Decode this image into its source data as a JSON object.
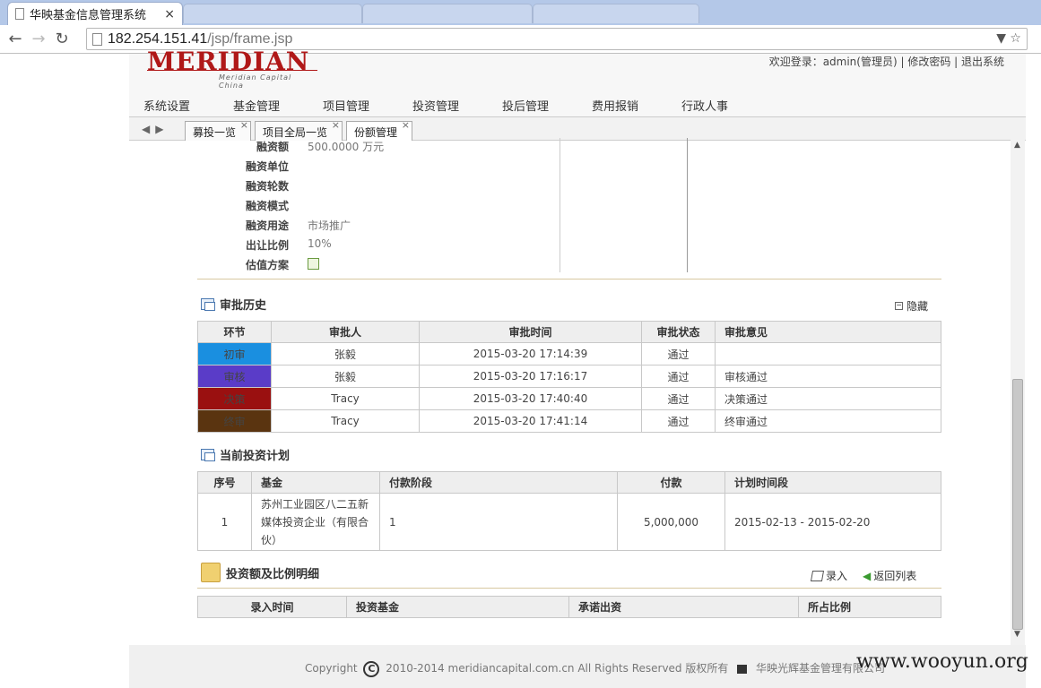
{
  "browser": {
    "tab_title": "华映基金信息管理系统",
    "tab_close": "×",
    "url_host": "182.254.151.41",
    "url_path": "/jsp/frame.jsp"
  },
  "header": {
    "logo_text": "MERIDIAN",
    "logo_sub": "Meridian Capital China",
    "userbar": "欢迎登录：admin(管理员) | 修改密码 | 退出系统",
    "nav": [
      "系统设置",
      "基金管理",
      "项目管理",
      "投资管理",
      "投后管理",
      "费用报销",
      "行政人事"
    ]
  },
  "tabs": [
    {
      "label": "募投一览",
      "close": "×"
    },
    {
      "label": "项目全局一览",
      "close": "×"
    },
    {
      "label": "份额管理",
      "close": "×"
    }
  ],
  "fields": [
    {
      "label": "融资额",
      "value": "500.0000 万元"
    },
    {
      "label": "融资单位",
      "value": ""
    },
    {
      "label": "融资轮数",
      "value": ""
    },
    {
      "label": "融资模式",
      "value": ""
    },
    {
      "label": "融资用途",
      "value": "市场推广"
    },
    {
      "label": "出让比例",
      "value": "10%"
    },
    {
      "label": "估值方案",
      "value": ""
    }
  ],
  "approval": {
    "title": "审批历史",
    "hide_label": "隐藏",
    "columns": [
      "环节",
      "审批人",
      "审批时间",
      "审批状态",
      "审批意见"
    ],
    "rows": [
      {
        "stage": "初审",
        "color": "#1a8fe0",
        "approver": "张毅",
        "time": "2015-03-20 17:14:39",
        "status": "通过",
        "opinion": ""
      },
      {
        "stage": "审核",
        "color": "#5a3cc8",
        "approver": "张毅",
        "time": "2015-03-20 17:16:17",
        "status": "通过",
        "opinion": "审核通过"
      },
      {
        "stage": "决策",
        "color": "#9a1010",
        "approver": "Tracy",
        "time": "2015-03-20 17:40:40",
        "status": "通过",
        "opinion": "决策通过"
      },
      {
        "stage": "终审",
        "color": "#5a3410",
        "approver": "Tracy",
        "time": "2015-03-20 17:41:14",
        "status": "通过",
        "opinion": "终审通过"
      }
    ]
  },
  "plan": {
    "title": "当前投资计划",
    "columns": [
      "序号",
      "基金",
      "付款阶段",
      "付款",
      "计划时间段"
    ],
    "rows": [
      {
        "no": "1",
        "fund": "苏州工业园区八二五新媒体投资企业（有限合伙）",
        "stage": "1",
        "amount": "5,000,000",
        "period": "2015-02-13 - 2015-02-20"
      }
    ]
  },
  "detail": {
    "title": "投资额及比例明细",
    "add_label": "录入",
    "back_label": "返回列表",
    "columns": [
      "录入时间",
      "投资基金",
      "承诺出资",
      "所占比例"
    ]
  },
  "footer": {
    "prefix": "Copyright",
    "c_symbol": "C",
    "text": "2010-2014 meridiancapital.com.cn All Rights Reserved 版权所有",
    "company": "华映光辉基金管理有限公司"
  },
  "watermark": "www.wooyun.org"
}
